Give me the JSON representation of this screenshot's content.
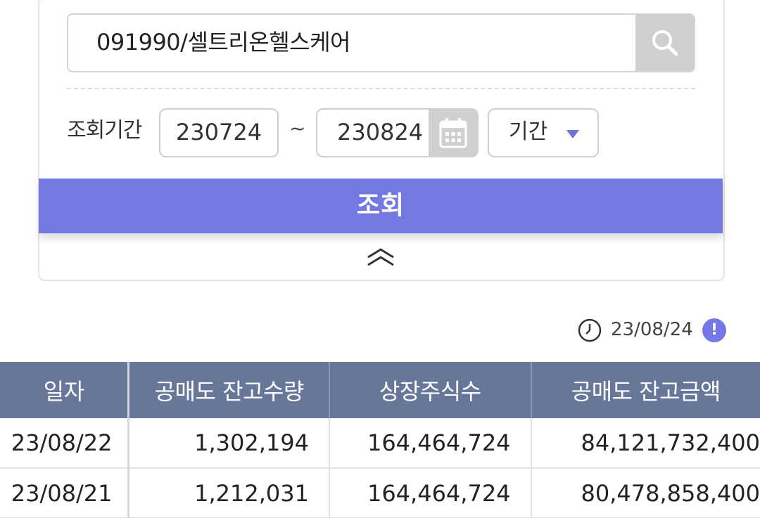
{
  "search": {
    "value": "091990/셀트리온헬스케어",
    "icon": "search-icon"
  },
  "period": {
    "label": "조회기간",
    "from": "230724",
    "separator": "~",
    "to": "230824",
    "calendar_icon": "calendar-icon",
    "select_value": "기간"
  },
  "query_button": {
    "label": "조회"
  },
  "collapse_icon": "chevron-double-up-icon",
  "timestamp": {
    "value": "23/08/24",
    "info_mark": "!"
  },
  "table": {
    "headers": [
      "일자",
      "공매도 잔고수량",
      "상장주식수",
      "공매도 잔고금액"
    ],
    "rows": [
      [
        "23/08/22",
        "1,302,194",
        "164,464,724",
        "84,121,732,400"
      ],
      [
        "23/08/21",
        "1,212,031",
        "164,464,724",
        "80,478,858,400"
      ]
    ]
  },
  "colors": {
    "accent": "#7478e3",
    "table_header": "#67779a"
  }
}
